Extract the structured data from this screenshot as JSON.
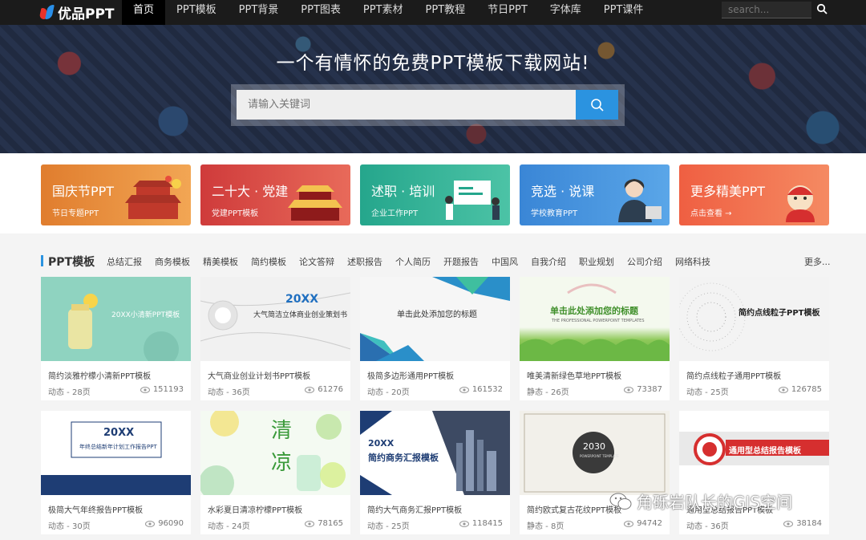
{
  "nav": {
    "logo_text": "优品PPT",
    "items": [
      {
        "label": "首页",
        "active": true
      },
      {
        "label": "PPT模板"
      },
      {
        "label": "PPT背景"
      },
      {
        "label": "PPT图表"
      },
      {
        "label": "PPT素材"
      },
      {
        "label": "PPT教程"
      },
      {
        "label": "节日PPT"
      },
      {
        "label": "字体库"
      },
      {
        "label": "PPT课件"
      }
    ],
    "search_placeholder": "search..."
  },
  "hero": {
    "title": "一个有情怀的免费PPT模板下载网站!",
    "search_placeholder": "请输入关键词"
  },
  "categories": [
    {
      "title": "国庆节PPT",
      "sub": "节日专题PPT",
      "color": "#e4883a"
    },
    {
      "title": "二十大 · 党建",
      "sub": "党建PPT模板",
      "color": "#d64545"
    },
    {
      "title": "述职 · 培训",
      "sub": "企业工作PPT",
      "color": "#2fae94"
    },
    {
      "title": "竞选 · 说课",
      "sub": "学校教育PPT",
      "color": "#3f8fd8"
    },
    {
      "title": "更多精美PPT",
      "sub": "点击查看 →",
      "color": "#ee6a4a"
    }
  ],
  "section": {
    "title": "PPT模板",
    "tags": [
      "总结汇报",
      "商务模板",
      "精美模板",
      "简约模板",
      "论文答辩",
      "述职报告",
      "个人简历",
      "开题报告",
      "中国风",
      "自我介绍",
      "职业规划",
      "公司介绍",
      "网络科技"
    ],
    "more": "更多..."
  },
  "cards": [
    {
      "title": "简约淡雅柠檬小清新PPT模板",
      "meta": "动态 - 28页",
      "views": "151193",
      "thumb_text": "20XX小清新PPT模板",
      "thumb_bg": "#8fd3c0"
    },
    {
      "title": "大气商业创业计划书PPT模板",
      "meta": "动态 - 36页",
      "views": "61276",
      "thumb_text": "20XX",
      "thumb_text2": "大气简洁立体商业创业策划书",
      "thumb_bg": "#f1f1f1"
    },
    {
      "title": "极简多边形通用PPT模板",
      "meta": "动态 - 20页",
      "views": "161532",
      "thumb_text": "单击此处添加您的标题",
      "thumb_bg": "#f6f6f6"
    },
    {
      "title": "唯美清新绿色草地PPT模板",
      "meta": "静态 - 26页",
      "views": "73387",
      "thumb_text": "单击此处添加您的标题",
      "thumb_text2": "THE PROFESSIONAL POWERPOINT TEMPLATES",
      "thumb_bg": "#eef6e4"
    },
    {
      "title": "简约点线粒子通用PPT模板",
      "meta": "动态 - 25页",
      "views": "126785",
      "thumb_text": "简约点线粒子PPT模板",
      "thumb_bg": "#f3f3f3"
    },
    {
      "title": "极简大气年终报告PPT模板",
      "meta": "动态 - 30页",
      "views": "96090",
      "thumb_text": "20XX",
      "thumb_text2": "年终总结新年计划工作报告PPT",
      "thumb_bg": "#ffffff"
    },
    {
      "title": "水彩夏日清凉柠檬PPT模板",
      "meta": "动态 - 24页",
      "views": "78165",
      "thumb_text": "清",
      "thumb_text2": "凉",
      "thumb_bg": "#f4faf2"
    },
    {
      "title": "简约大气商务汇报PPT模板",
      "meta": "动态 - 25页",
      "views": "118415",
      "thumb_text": "20XX",
      "thumb_text2": "简约商务汇报模板",
      "thumb_bg": "#ffffff"
    },
    {
      "title": "简约欧式复古花纹PPT模板",
      "meta": "静态 - 8页",
      "views": "94742",
      "thumb_text": "2030",
      "thumb_text2": "POWERPOINT TEMPLATE",
      "thumb_bg": "#f2f0ea"
    },
    {
      "title": "通用型总结报告PPT模板",
      "meta": "动态 - 36页",
      "views": "38184",
      "thumb_text": "通用型总结报告模板",
      "thumb_bg": "#ffffff"
    }
  ],
  "watermark": {
    "text": "角砾岩队长的GIS空间"
  },
  "colors": {
    "accent": "#2b93e0",
    "nav_bg": "#1b1b1b"
  }
}
